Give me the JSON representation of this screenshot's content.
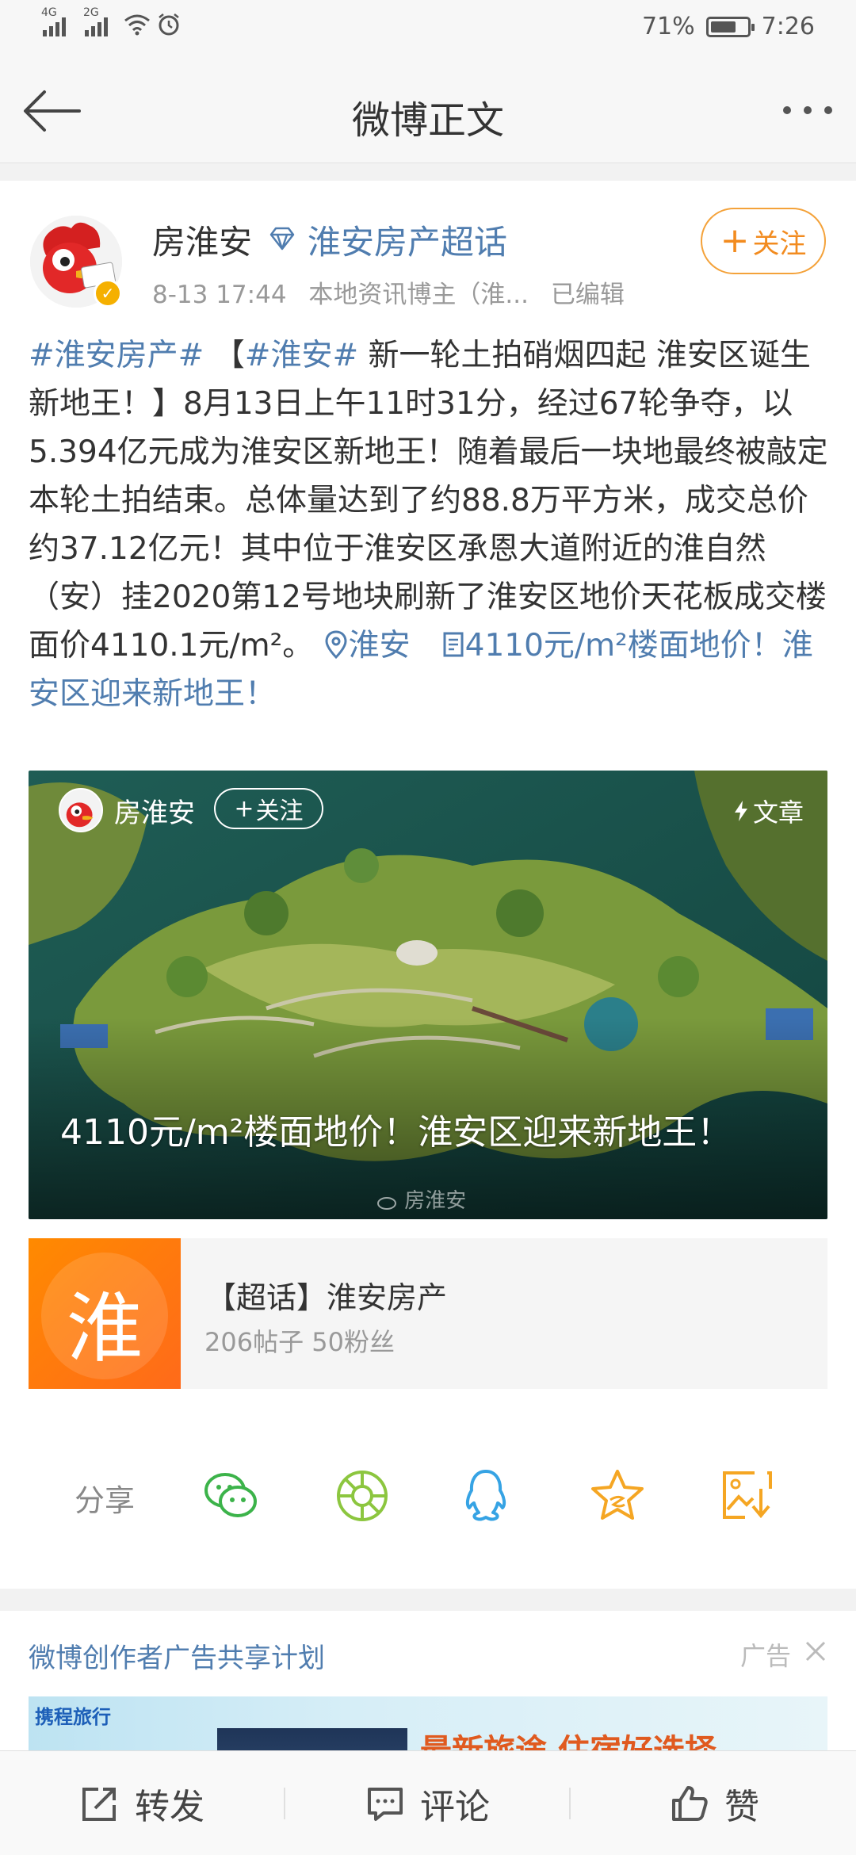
{
  "status_bar": {
    "net1": "4G",
    "net2": "2G",
    "battery": "71%",
    "battery_level": 0.71,
    "time": "7:26"
  },
  "nav": {
    "title": "微博正文"
  },
  "post": {
    "author": "房淮安",
    "super_topic": "淮安房产超话",
    "time": "8-13 17:44",
    "source": "本地资讯博主（淮...",
    "edited": "已编辑",
    "follow_label": "关注",
    "text_hashtag1": "#淮安房产#",
    "text_bracket_open": " 【",
    "text_hashtag2": "#淮安#",
    "text_body": " 新一轮土拍硝烟四起 淮安区诞生新地王！】8月13日上午11时31分，经过67轮争夺，以5.394亿元成为淮安区新地王！随着最后一块地最终被敲定本轮土拍结束。总体量达到了约88.8万平方米，成交总价约37.12亿元！其中位于淮安区承恩大道附近的淮自然（安）挂2020第12号地块刷新了淮安区地价天花板成交楼面价4110.1元/m²。",
    "text_location": "淮安",
    "text_article_link": "4110元/m²楼面地价！淮安区迎来新地王！"
  },
  "article_card": {
    "author": "房淮安",
    "follow_label": "关注",
    "tag": "文章",
    "title": "4110元/m²楼面地价！淮安区迎来新地王！",
    "watermark": "房淮安"
  },
  "topic_card": {
    "thumb_char": "淮",
    "title": "【超话】淮安房产",
    "stats": "206帖子 50粉丝"
  },
  "share": {
    "label": "分享"
  },
  "ad": {
    "title": "微博创作者广告共享计划",
    "label": "广告",
    "brand": "携程旅行",
    "slogan": "最新旅途 住宿好选择"
  },
  "bottom_bar": {
    "repost": "转发",
    "comment": "评论",
    "like": "赞"
  },
  "colors": {
    "link_blue": "#507daf",
    "follow_orange": "#f28b1f",
    "verified_gold": "#f5b000"
  }
}
